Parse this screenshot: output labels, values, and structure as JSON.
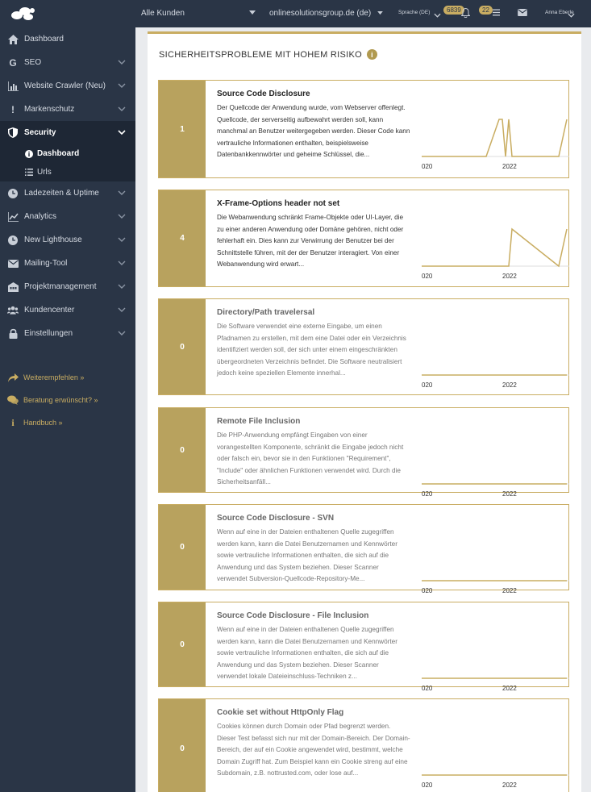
{
  "topbar": {
    "client_select": "Alle Kunden",
    "domain_select": "onlinesolutionsgroup.de (de)",
    "language": "Sprache (DE)",
    "notifications_count": "6839",
    "tasks_count": "22",
    "user": "Anna Eberle"
  },
  "sidebar": {
    "items": [
      {
        "label": "Dashboard",
        "icon": "home-icon"
      },
      {
        "label": "SEO",
        "icon": "google-icon"
      },
      {
        "label": "Website Crawler (Neu)",
        "icon": "bar-chart-icon"
      },
      {
        "label": "Markenschutz",
        "icon": "exclamation-icon"
      },
      {
        "label": "Security",
        "icon": "shield-icon"
      },
      {
        "label": "Ladezeiten & Uptime",
        "icon": "clock-icon"
      },
      {
        "label": "Analytics",
        "icon": "line-chart-icon"
      },
      {
        "label": "New Lighthouse",
        "icon": "clock-icon"
      },
      {
        "label": "Mailing-Tool",
        "icon": "envelope-icon"
      },
      {
        "label": "Projektmanagement",
        "icon": "building-icon"
      },
      {
        "label": "Kundencenter",
        "icon": "users-icon"
      },
      {
        "label": "Einstellungen",
        "icon": "lock-icon"
      }
    ],
    "security_sub": [
      {
        "label": "Dashboard",
        "icon": "info-icon"
      },
      {
        "label": "Urls",
        "icon": "list-icon"
      }
    ],
    "extras": [
      {
        "label": "Weiterempfehlen »",
        "icon": "share-icon"
      },
      {
        "label": "Beratung erwünscht? »",
        "icon": "comments-icon"
      },
      {
        "label": "Handbuch »",
        "icon": "info-icon"
      }
    ]
  },
  "main": {
    "section_title": "SICHERHEITSPROBLEME MIT HOHEM RISIKO",
    "axis_ticks": [
      "020",
      "2022"
    ],
    "cards": [
      {
        "count": "1",
        "title": "Source Code Disclosure",
        "description": "Der Quellcode der Anwendung wurde, vom Webserver offenlegt. Quellcode, der serverseitig aufbewahrt werden soll, kann manchmal an Benutzer weitergegeben werden. Dieser Code kann vertrauliche Informationen enthalten, beispielsweise Datenbankkennwörter und geheime Schlüssel, die..."
      },
      {
        "count": "4",
        "title": "X-Frame-Options header not set",
        "description": "Die Webanwendung schränkt Frame-Objekte oder UI-Layer, die zu einer anderen Anwendung oder Domäne gehören, nicht oder fehlerhaft ein. Dies kann zur Verwirrung der Benutzer bei der Schnittstelle führen, mit der der Benutzer interagiert. Von einer Webanwendung wird erwart..."
      },
      {
        "count": "0",
        "title": "Directory/Path travelersal",
        "description": "Die Software verwendet eine externe Eingabe, um einen Pfadnamen zu erstellen, mit dem eine Datei oder ein Verzeichnis identifiziert werden soll, der sich unter einem eingeschränkten übergeordneten Verzeichnis befindet. Die Software neutralisiert jedoch keine speziellen Elemente innerhal..."
      },
      {
        "count": "0",
        "title": "Remote File Inclusion",
        "description": "Die PHP-Anwendung empfängt Eingaben von einer vorangestellten Komponente, schränkt die Eingabe jedoch nicht oder falsch ein, bevor sie in den Funktionen \"Requirement\", \"Include\" oder ähnlichen Funktionen verwendet wird. Durch die Sicherheitsanfäll..."
      },
      {
        "count": "0",
        "title": "Source Code Disclosure - SVN",
        "description": "Wenn auf eine in der Dateien enthaltenen Quelle zugegriffen werden kann, kann die Datei Benutzernamen und Kennwörter sowie vertrauliche Informationen enthalten, die sich auf die Anwendung und das System beziehen. Dieser Scanner verwendet Subversion-Quellcode-Repository-Me..."
      },
      {
        "count": "0",
        "title": "Source Code Disclosure - File Inclusion",
        "description": "Wenn auf eine in der Dateien enthaltenen Quelle zugegriffen werden kann, kann die Datei Benutzernamen und Kennwörter sowie vertrauliche Informationen enthalten, die sich auf die Anwendung und das System beziehen. Dieser Scanner verwendet lokale Dateieinschluss-Techniken z..."
      },
      {
        "count": "0",
        "title": "Cookie set without HttpOnly Flag",
        "description": "Cookies können durch Domain oder Pfad begrenzt werden. Dieser Test befasst sich nur mit der Domain-Bereich. Der Domain-Bereich, der auf ein Cookie angewendet wird, bestimmt, welche Domain Zugriff hat. Zum Beispiel kann ein Cookie streng auf eine Subdomain, z.B. nottrusted.com, oder lose auf..."
      }
    ]
  },
  "colors": {
    "gold": "#c9ad62",
    "count_bg": "#b8a25e",
    "sidebar_bg": "#2a3546",
    "sidebar_active": "#1e2735"
  },
  "chart_data": [
    {
      "type": "line",
      "series": [
        {
          "values": [
            0,
            0,
            1,
            1,
            0,
            1,
            0,
            0,
            1
          ]
        }
      ]
    },
    {
      "type": "line",
      "series": [
        {
          "values": [
            0,
            0,
            0,
            0,
            0,
            0,
            4,
            0,
            4
          ]
        }
      ]
    },
    {
      "type": "line",
      "series": [
        {
          "values": [
            0,
            0,
            0,
            0,
            0,
            0,
            0,
            0,
            0
          ]
        }
      ]
    },
    {
      "type": "line",
      "series": [
        {
          "values": [
            0,
            0,
            0,
            0,
            0,
            0,
            0,
            0,
            0
          ]
        }
      ]
    },
    {
      "type": "line",
      "series": [
        {
          "values": [
            0,
            0,
            0,
            0,
            0,
            0,
            0,
            0,
            0
          ]
        }
      ]
    },
    {
      "type": "line",
      "series": [
        {
          "values": [
            0,
            0,
            0,
            0,
            0,
            0,
            0,
            0,
            0
          ]
        }
      ]
    },
    {
      "type": "line",
      "series": [
        {
          "values": [
            0,
            0,
            0,
            0,
            0,
            0,
            0,
            0,
            0
          ]
        }
      ]
    }
  ]
}
